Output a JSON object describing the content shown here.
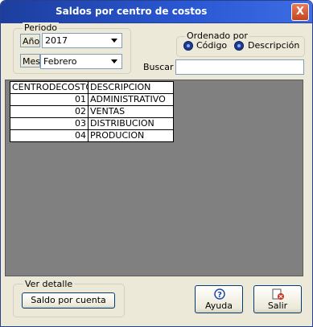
{
  "window": {
    "title": "Saldos por centro de costos",
    "close_label": "X"
  },
  "periodo": {
    "legend": "Periodo",
    "anio_label": "Año",
    "anio_value": "2017",
    "mes_label": "Mes",
    "mes_value": "Febrero"
  },
  "ordenado": {
    "legend": "Ordenado por",
    "options": [
      {
        "label": "Código",
        "selected": true
      },
      {
        "label": "Descripción",
        "selected": false
      }
    ]
  },
  "search": {
    "label": "Buscar",
    "value": ""
  },
  "grid": {
    "columns": [
      "CENTRODECOSTO",
      "DESCRIPCION"
    ],
    "rows": [
      {
        "code": "01",
        "desc": "ADMINISTRATIVO"
      },
      {
        "code": "02",
        "desc": "VENTAS"
      },
      {
        "code": "03",
        "desc": "DISTRIBUCION"
      },
      {
        "code": "04",
        "desc": "PRODUCION"
      }
    ]
  },
  "detalle": {
    "legend": "Ver detalle",
    "button_label": "Saldo por cuenta"
  },
  "buttons": {
    "ayuda": "Ayuda",
    "salir": "Salir"
  },
  "icons": {
    "close": "close-icon",
    "dropdown": "chevron-down-icon",
    "help": "help-icon",
    "exit": "exit-icon"
  },
  "colors": {
    "titlebar": "#2a58d4",
    "grid_background": "#808080",
    "window": "#ece9d8"
  }
}
